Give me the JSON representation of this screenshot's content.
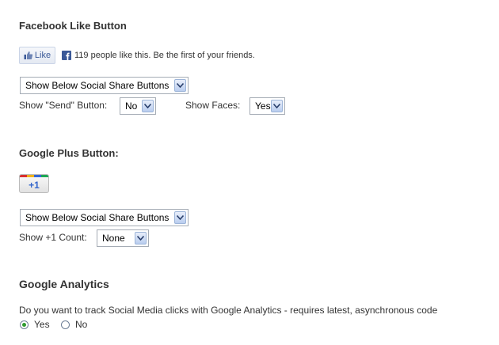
{
  "facebook": {
    "heading": "Facebook Like Button",
    "like_label": "Like",
    "like_text": "119 people like this. Be the first of your friends.",
    "position_select": "Show Below Social Share Buttons",
    "send_label": "Show \"Send\" Button:",
    "send_value": "No",
    "faces_label": "Show Faces:",
    "faces_value": "Yes"
  },
  "gplus": {
    "heading": "Google Plus Button:",
    "button_label": "+1",
    "position_select": "Show Below Social Share Buttons",
    "count_label": "Show +1 Count:",
    "count_value": "None"
  },
  "analytics": {
    "heading": "Google Analytics",
    "question": "Do you want to track Social Media clicks with Google Analytics - requires latest, asynchronous code",
    "options": [
      "Yes",
      "No"
    ],
    "selected": "Yes"
  },
  "colors": {
    "facebook_blue": "#3b5998",
    "gplus_blue": "#3366cc",
    "radio_green": "#2f9b2f"
  }
}
